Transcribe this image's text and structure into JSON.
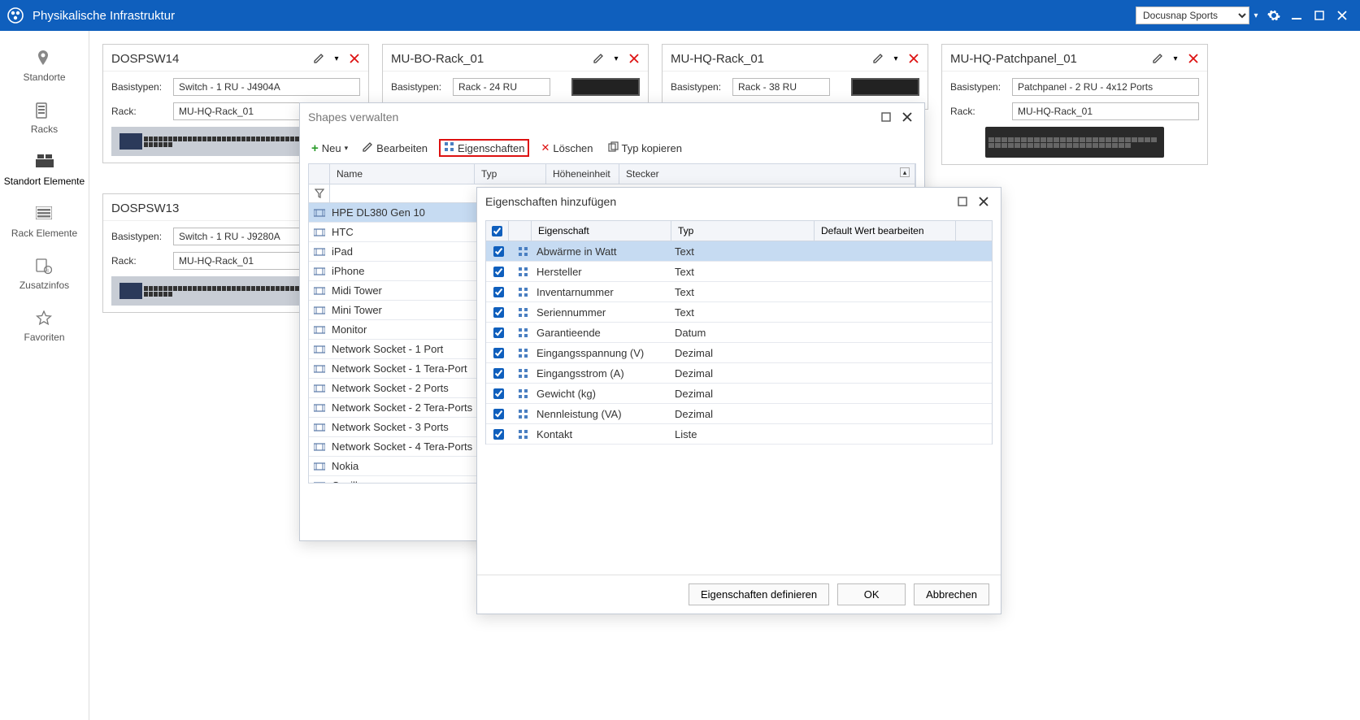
{
  "titlebar": {
    "title": "Physikalische Infrastruktur",
    "company_selected": "Docusnap Sports"
  },
  "leftnav": [
    {
      "label": "Standorte"
    },
    {
      "label": "Racks"
    },
    {
      "label": "Standort Elemente"
    },
    {
      "label": "Rack Elemente"
    },
    {
      "label": "Zusatzinfos"
    },
    {
      "label": "Favoriten"
    }
  ],
  "panels": {
    "p1": {
      "title": "DOSPSW14",
      "basistypen_label": "Basistypen:",
      "basistypen_value": "Switch - 1 RU - J4904A",
      "rack_label": "Rack:",
      "rack_value": "MU-HQ-Rack_01"
    },
    "p2": {
      "title": "MU-BO-Rack_01",
      "basistypen_label": "Basistypen:",
      "basistypen_value": "Rack - 24 RU"
    },
    "p3": {
      "title": "MU-HQ-Rack_01",
      "basistypen_label": "Basistypen:",
      "basistypen_value": "Rack - 38 RU"
    },
    "p4": {
      "title": "MU-HQ-Patchpanel_01",
      "basistypen_label": "Basistypen:",
      "basistypen_value": "Patchpanel - 2 RU - 4x12 Ports",
      "rack_label": "Rack:",
      "rack_value": "MU-HQ-Rack_01"
    },
    "p5": {
      "title": "DOSPSW13",
      "basistypen_label": "Basistypen:",
      "basistypen_value": "Switch - 1 RU - J9280A",
      "rack_label": "Rack:",
      "rack_value": "MU-HQ-Rack_01"
    }
  },
  "shapes_dialog": {
    "title": "Shapes verwalten",
    "toolbar": {
      "neu": "Neu",
      "bearbeiten": "Bearbeiten",
      "eigenschaften": "Eigenschaften",
      "loeschen": "Löschen",
      "typ_kopieren": "Typ kopieren"
    },
    "columns": {
      "name": "Name",
      "typ": "Typ",
      "hoehe": "Höheneinheit",
      "stecker": "Stecker"
    },
    "rows": [
      "HPE DL380 Gen 10",
      "HTC",
      "iPad",
      "iPhone",
      "Midi Tower",
      "Mini Tower",
      "Monitor",
      "Network Socket - 1 Port",
      "Network Socket - 1 Tera-Port",
      "Network Socket - 2 Ports",
      "Network Socket - 2 Tera-Ports",
      "Network Socket - 3 Ports",
      "Network Socket - 4 Tera-Ports",
      "Nokia",
      "Oscilloscope"
    ]
  },
  "props_dialog": {
    "title": "Eigenschaften hinzufügen",
    "columns": {
      "eigenschaft": "Eigenschaft",
      "typ": "Typ",
      "default": "Default Wert bearbeiten"
    },
    "rows": [
      {
        "name": "Abwärme in Watt",
        "type": "Text"
      },
      {
        "name": "Hersteller",
        "type": "Text"
      },
      {
        "name": "Inventarnummer",
        "type": "Text"
      },
      {
        "name": "Seriennummer",
        "type": "Text"
      },
      {
        "name": "Garantieende",
        "type": "Datum"
      },
      {
        "name": "Eingangsspannung (V)",
        "type": "Dezimal"
      },
      {
        "name": "Eingangsstrom (A)",
        "type": "Dezimal"
      },
      {
        "name": "Gewicht (kg)",
        "type": "Dezimal"
      },
      {
        "name": "Nennleistung (VA)",
        "type": "Dezimal"
      },
      {
        "name": "Kontakt",
        "type": "Liste"
      }
    ],
    "buttons": {
      "define": "Eigenschaften definieren",
      "ok": "OK",
      "cancel": "Abbrechen"
    }
  }
}
